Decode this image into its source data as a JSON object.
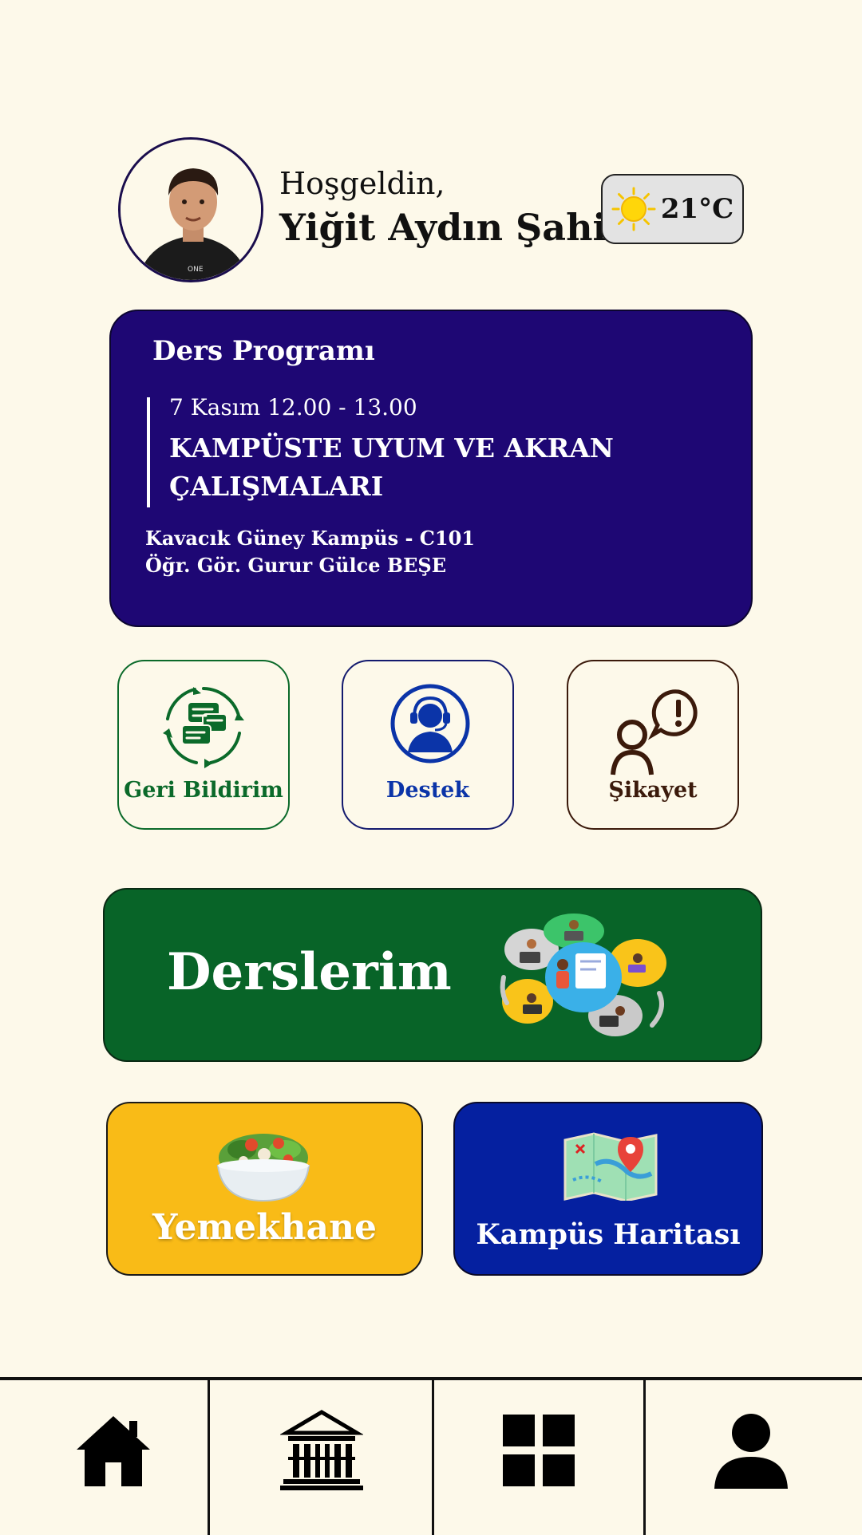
{
  "header": {
    "greeting": "Hoşgeldin,",
    "user_name": "Yiğit Aydın Şahin",
    "avatar_icon": "user-avatar-photo"
  },
  "weather": {
    "icon": "sun-icon",
    "temperature": "21°C"
  },
  "schedule": {
    "title": "Ders Programı",
    "time": "7 Kasım 12.00 - 13.00",
    "course_name": "KAMPÜSTE UYUM VE AKRAN ÇALIŞMALARI",
    "location": "Kavacık Güney Kampüs - C101",
    "instructor": "Öğr. Gör. Gurur Gülce BEŞE"
  },
  "quick_actions": [
    {
      "label": "Geri Bildirim",
      "icon": "feedback-chat-icon",
      "color": "#0b6a2a"
    },
    {
      "label": "Destek",
      "icon": "support-headset-icon",
      "color": "#0b34a8"
    },
    {
      "label": "Şikayet",
      "icon": "complaint-person-icon",
      "color": "#3b1a0b"
    }
  ],
  "cards": {
    "courses": {
      "label": "Derslerim",
      "color": "#086428"
    },
    "cafeteria": {
      "label": "Yemekhane",
      "color": "#f9bb17"
    },
    "campus_map": {
      "label": "Kampüs Haritası",
      "color": "#0520a0"
    }
  },
  "nav": [
    {
      "icon": "home-icon"
    },
    {
      "icon": "campus-building-icon"
    },
    {
      "icon": "grid-menu-icon"
    },
    {
      "icon": "profile-icon"
    }
  ],
  "colors": {
    "background": "#fdf9ea",
    "schedule_bg": "#1e0774"
  }
}
